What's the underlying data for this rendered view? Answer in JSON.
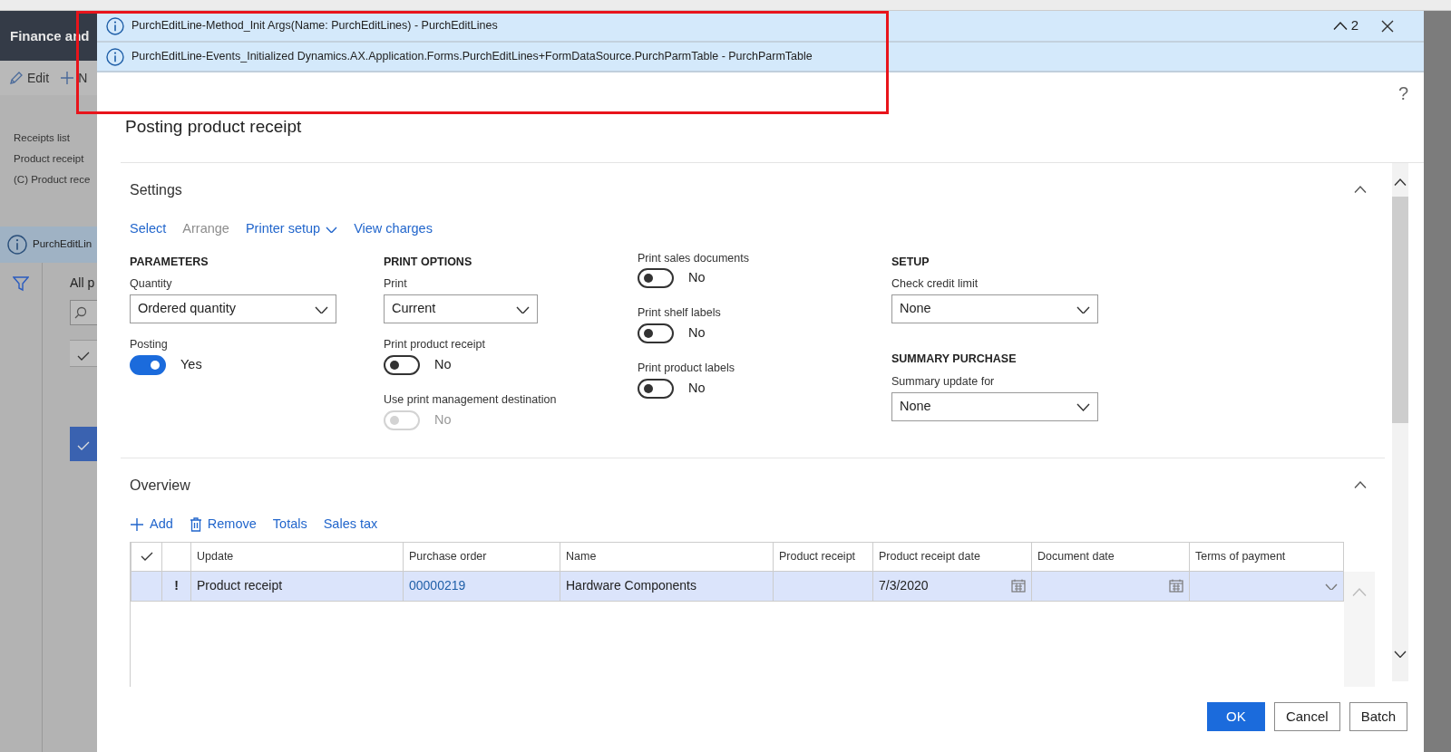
{
  "background": {
    "app_title": "Finance and",
    "actions": [
      {
        "kind": "edit",
        "label": "Edit"
      },
      {
        "kind": "new",
        "label": "N"
      }
    ],
    "breadcrumbs": [
      "Receipts list",
      "Product receipt",
      "(C) Product rece"
    ],
    "message": "PurchEditLin",
    "list_title": "All p"
  },
  "message_bar": {
    "count": "2",
    "messages": [
      "PurchEditLine-Method_Init Args(Name: PurchEditLines) - PurchEditLines",
      "PurchEditLine-Events_Initialized Dynamics.AX.Application.Forms.PurchEditLines+FormDataSource.PurchParmTable - PurchParmTable"
    ]
  },
  "dialog": {
    "help": "?",
    "title": "Posting product receipt",
    "settings": {
      "title": "Settings",
      "expanded": true,
      "toolbar": [
        {
          "label": "Select",
          "disabled": false,
          "dropdown": false
        },
        {
          "label": "Arrange",
          "disabled": true,
          "dropdown": false
        },
        {
          "label": "Printer setup",
          "disabled": false,
          "dropdown": true
        },
        {
          "label": "View charges",
          "disabled": false,
          "dropdown": false
        }
      ],
      "columns": [
        {
          "items": [
            {
              "kind": "heading",
              "text": "PARAMETERS"
            },
            {
              "kind": "select",
              "label": "Quantity",
              "value": "Ordered quantity"
            },
            {
              "kind": "toggle",
              "label": "Posting",
              "on": true,
              "disabled": false,
              "value": "Yes"
            }
          ]
        },
        {
          "items": [
            {
              "kind": "heading",
              "text": "PRINT OPTIONS"
            },
            {
              "kind": "select",
              "label": "Print",
              "value": "Current"
            },
            {
              "kind": "toggle",
              "label": "Print product receipt",
              "on": false,
              "disabled": false,
              "value": "No"
            },
            {
              "kind": "toggle",
              "label": "Use print management destination",
              "on": false,
              "disabled": true,
              "value": "No"
            }
          ]
        },
        {
          "items": [
            {
              "kind": "toggle",
              "label": "Print sales documents",
              "on": false,
              "disabled": false,
              "value": "No"
            },
            {
              "kind": "toggle",
              "label": "Print shelf labels",
              "on": false,
              "disabled": false,
              "value": "No"
            },
            {
              "kind": "toggle",
              "label": "Print product labels",
              "on": false,
              "disabled": false,
              "value": "No"
            }
          ]
        },
        {
          "items": [
            {
              "kind": "heading",
              "text": "SETUP"
            },
            {
              "kind": "select",
              "label": "Check credit limit",
              "value": "None"
            },
            {
              "kind": "heading",
              "text": "SUMMARY PURCHASE"
            },
            {
              "kind": "select",
              "label": "Summary update for",
              "value": "None"
            }
          ]
        }
      ]
    },
    "overview": {
      "title": "Overview",
      "expanded": true,
      "toolbar": [
        {
          "label": "Add",
          "kind": "add"
        },
        {
          "label": "Remove",
          "kind": "remove"
        },
        {
          "label": "Totals",
          "kind": "plain"
        },
        {
          "label": "Sales tax",
          "kind": "plain"
        }
      ],
      "grid": {
        "columns": [
          {
            "kind": "check"
          },
          {
            "kind": "flag"
          },
          {
            "kind": "text",
            "label": "Update"
          },
          {
            "kind": "link",
            "label": "Purchase order"
          },
          {
            "kind": "text",
            "label": "Name"
          },
          {
            "kind": "text",
            "label": "Product receipt"
          },
          {
            "kind": "date",
            "label": "Product receipt date"
          },
          {
            "kind": "date",
            "label": "Document date"
          },
          {
            "kind": "select",
            "label": "Terms of payment"
          }
        ],
        "rows": [
          {
            "selected": true,
            "cells": [
              null,
              "!",
              "Product receipt",
              "00000219",
              "Hardware Components",
              null,
              "7/3/2020",
              null,
              null
            ]
          }
        ]
      }
    },
    "buttons": [
      {
        "label": "OK",
        "kind": "primary"
      },
      {
        "label": "Cancel",
        "kind": "default"
      },
      {
        "label": "Batch",
        "kind": "default"
      }
    ]
  }
}
